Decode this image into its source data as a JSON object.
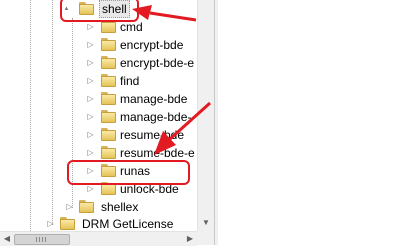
{
  "tree": {
    "shell_label": "shell",
    "children": [
      {
        "label": "cmd"
      },
      {
        "label": "encrypt-bde"
      },
      {
        "label": "encrypt-bde-e"
      },
      {
        "label": "find"
      },
      {
        "label": "manage-bde"
      },
      {
        "label": "manage-bde-"
      },
      {
        "label": "resume-bde"
      },
      {
        "label": "resume-bde-e"
      },
      {
        "label": "runas"
      },
      {
        "label": "unlock-bde"
      }
    ],
    "shellex_label": "shellex",
    "drm_label": "DRM GetLicense"
  },
  "icons": {
    "expanded": "▲",
    "collapsed": "▷",
    "scroll_left": "◀",
    "scroll_right": "▶",
    "scroll_up": "▲",
    "scroll_down": "▼"
  },
  "colors": {
    "callout": "#e21b22",
    "folder": "#e6c35a"
  }
}
